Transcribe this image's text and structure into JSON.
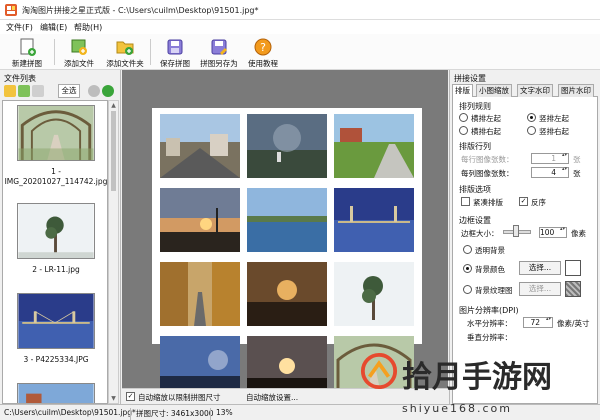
{
  "window": {
    "title": "淘淘图片拼接之星正式版 - C:\\Users\\cuilm\\Desktop\\91501.jpg*"
  },
  "menu": [
    "文件(F)",
    "编辑(E)",
    "帮助(H)"
  ],
  "toolbar": [
    "新建拼图",
    "添加文件",
    "添加文件夹",
    "保存拼图",
    "拼图另存为",
    "使用教程"
  ],
  "file_list": {
    "title": "文件列表",
    "select_all": "全选",
    "items": [
      {
        "caption1": "1 -",
        "caption2": "IMG_20201027_114742.jpg"
      },
      {
        "caption1": "2 - LR-11.jpg"
      },
      {
        "caption1": "3 - P4225334.JPG"
      }
    ]
  },
  "canvas": {
    "fit_checkbox": "自动缩放以限制拼图尺寸",
    "fit_checked": true,
    "zoom_setting": "自动缩放设置..."
  },
  "settings": {
    "title": "拼接设置",
    "tabs": [
      "排版",
      "小图缩放",
      "文字水印",
      "图片水印"
    ],
    "active_tab": "排版",
    "order_group": "排列规则",
    "order_options": [
      "横排左起",
      "竖排左起",
      "横排右起",
      "竖排右起"
    ],
    "order_selected": "竖排左起",
    "rows_group": "排版行列",
    "per_row_label": "每行图像张数：",
    "per_row_value": "1",
    "per_row_unit": "张",
    "per_col_label": "每列图像张数：",
    "per_col_value": "4",
    "per_col_unit": "张",
    "options_group": "排版选项",
    "compact_label": "紧凑排版",
    "compact_checked": false,
    "reverse_label": "反序",
    "reverse_checked": true,
    "border_group": "边框设置",
    "border_size_label": "边框大小：",
    "border_size_value": "100",
    "border_size_unit": "像素",
    "bg_transparent": "透明背景",
    "bg_color": "背景颜色",
    "bg_texture": "背景纹理图",
    "bg_selected": "背景颜色",
    "choose_button": "选择...",
    "dpi_group": "图片分辨率(DPI)",
    "hdpi_label": "水平分辨率：",
    "hdpi_value": "72",
    "hdpi_unit": "像素/英寸",
    "vdpi_label": "垂直分辨率："
  },
  "status": {
    "path": "C:\\Users\\cuilm\\Desktop\\91501.jpg*",
    "size": "拼图尺寸: 3461x3000",
    "zoom": "13%"
  },
  "watermark": {
    "text": "拾月手游网",
    "url": "shiyue168.com"
  }
}
